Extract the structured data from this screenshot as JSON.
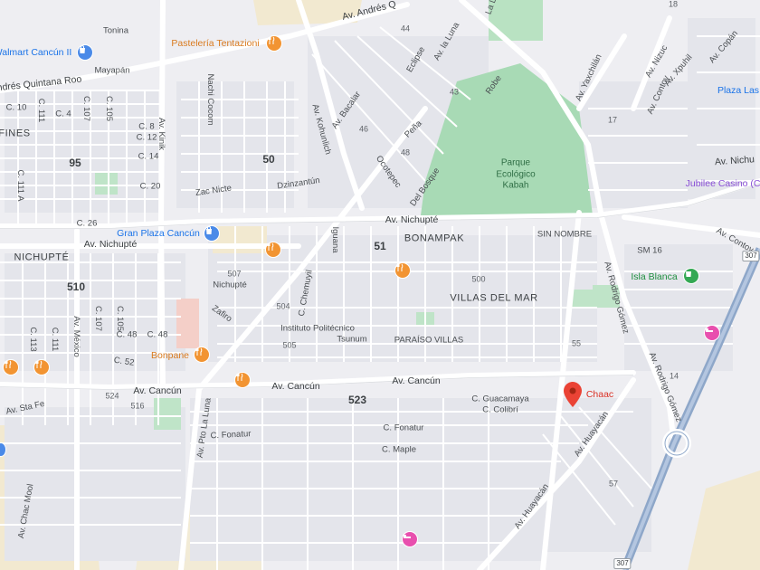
{
  "colors": {
    "background": "#eeeef2",
    "block": "#e3e4ea",
    "road": "#ffffff",
    "highway": "#8ea7c9",
    "park": "#a8dab5",
    "sand": "#f2e9d0",
    "food_poi": "#f29432",
    "shop_poi": "#4a8ae8",
    "pin": "#ea4335"
  },
  "labels": {
    "av_andres_q": "Av. Andrés Q",
    "av_andres_quintana_roo": "Andrés Quintana Roo",
    "tonina": "Tonina",
    "mayapan": "Mayapán",
    "la_luna_top": "La L",
    "av_la_luna": "Av. la Luna",
    "eclipse": "Eclipse",
    "robe": "Robe",
    "av_kohunlich": "Av. Kohunlich",
    "av_bacalar": "Av. Bacalar",
    "nachi_cocom": "Nachi Cocom",
    "pena": "Peña",
    "ocotepec": "Ocotepec",
    "del_bosque": "Del Bosque",
    "zac_nicte": "Zac Nicte",
    "dzinzantun": "Dzinzantún",
    "av_kinik": "Av. Kinik",
    "fines": "FINES",
    "c_4": "C. 4",
    "c_107": "C. 107",
    "c_105": "C. 105",
    "c_111": "C. 111",
    "c_10": "C. 10",
    "c_8": "C. 8",
    "c_12": "C. 12",
    "c_14": "C. 14",
    "c_20": "C. 20",
    "c_111a": "C. 111 A",
    "c_26": "C. 26",
    "av_nichupte": "Av. Nichupté",
    "av_nichupte_2": "Av. Nichupté",
    "av_nichu_right": "Av. Nichu",
    "nichupte": "NICHUPTÉ",
    "iguana": "Iguana",
    "bonampak": "BONAMPAK",
    "sin_nombre": "SIN NOMBRE",
    "av_yaxchilan": "Av. Yaxchilán",
    "av_xpuhil": "Av. Xpuhil",
    "av_nizuc": "Av. Nizuc",
    "av_contoy": "Av. Contoy",
    "av_contoy_2": "Av. Contoy",
    "av_copan": "Av. Copán",
    "sm_16": "SM 16",
    "villas_del_mar": "VILLAS DEL MAR",
    "av_rodrigo_gomez": "Av. Rodrigo Gómez",
    "av_rodrigo_gomez_2": "Av. Rodrigo Gómez",
    "nichupte_street": "Nichupté",
    "zafiro": "Zafiro",
    "c_chemuyil": "C. Chemuyil",
    "instituto": "Instituto Politécnico",
    "tsunum": "Tsunum",
    "paraiso_villas": "PARAÍSO VILLAS",
    "c_48": "C. 48",
    "c_48b": "C. 48",
    "c_52": "C. 52",
    "c_113": "C. 113",
    "c_111b": "C. 111",
    "c_107b": "C. 107",
    "c_105b": "C. 105",
    "av_mexico": "Av. México",
    "av_cancun_1": "Av. Cancún",
    "av_cancun_2": "Av. Cancún",
    "av_cancun_3": "Av. Cancún",
    "av_sta_fe": "Av. Sta Fe",
    "c_guacamaya": "C. Guacamaya",
    "c_colibri": "C. Colibrí",
    "av_huayacan": "Av. Huayacán",
    "av_huayacan_2": "Av. Huayacán",
    "c_fonatur": "C. Fonatur",
    "c_fonatur_2": "C. Fonatur",
    "c_maple": "C. Maple",
    "av_pto_la_luna": "Av. Pto La Luna",
    "av_chac_mool": "Av. Chac Mool"
  },
  "numbers": {
    "n18": "18",
    "n44": "44",
    "n43": "43",
    "n46": "46",
    "n48": "48",
    "n95": "95",
    "n50": "50",
    "n17": "17",
    "n51": "51",
    "n510": "510",
    "n507": "507",
    "n500": "500",
    "n504": "504",
    "n505": "505",
    "n55": "55",
    "n14": "14",
    "n524": "524",
    "n516": "516",
    "n523": "523",
    "n57": "57"
  },
  "pois": {
    "walmart": "Walmart Cancún II",
    "pasteleria": "Pastelería Tentazioni",
    "gran_plaza": "Gran Plaza Cancún",
    "bonpane": "Bonpane",
    "isla_blanca": "Isla Blanca",
    "jubilee": "Jubilee Casino (Ca",
    "plaza_las": "Plaza Las",
    "chaac": "Chaac",
    "park": "Parque Ecológico Kabah"
  },
  "icons": {
    "food": "fork-knife-icon",
    "shop": "shopping-bag-icon",
    "hotel": "bed-icon",
    "pin": "map-pin-icon"
  },
  "shields": {
    "s307a": "307",
    "s307b": "307"
  }
}
